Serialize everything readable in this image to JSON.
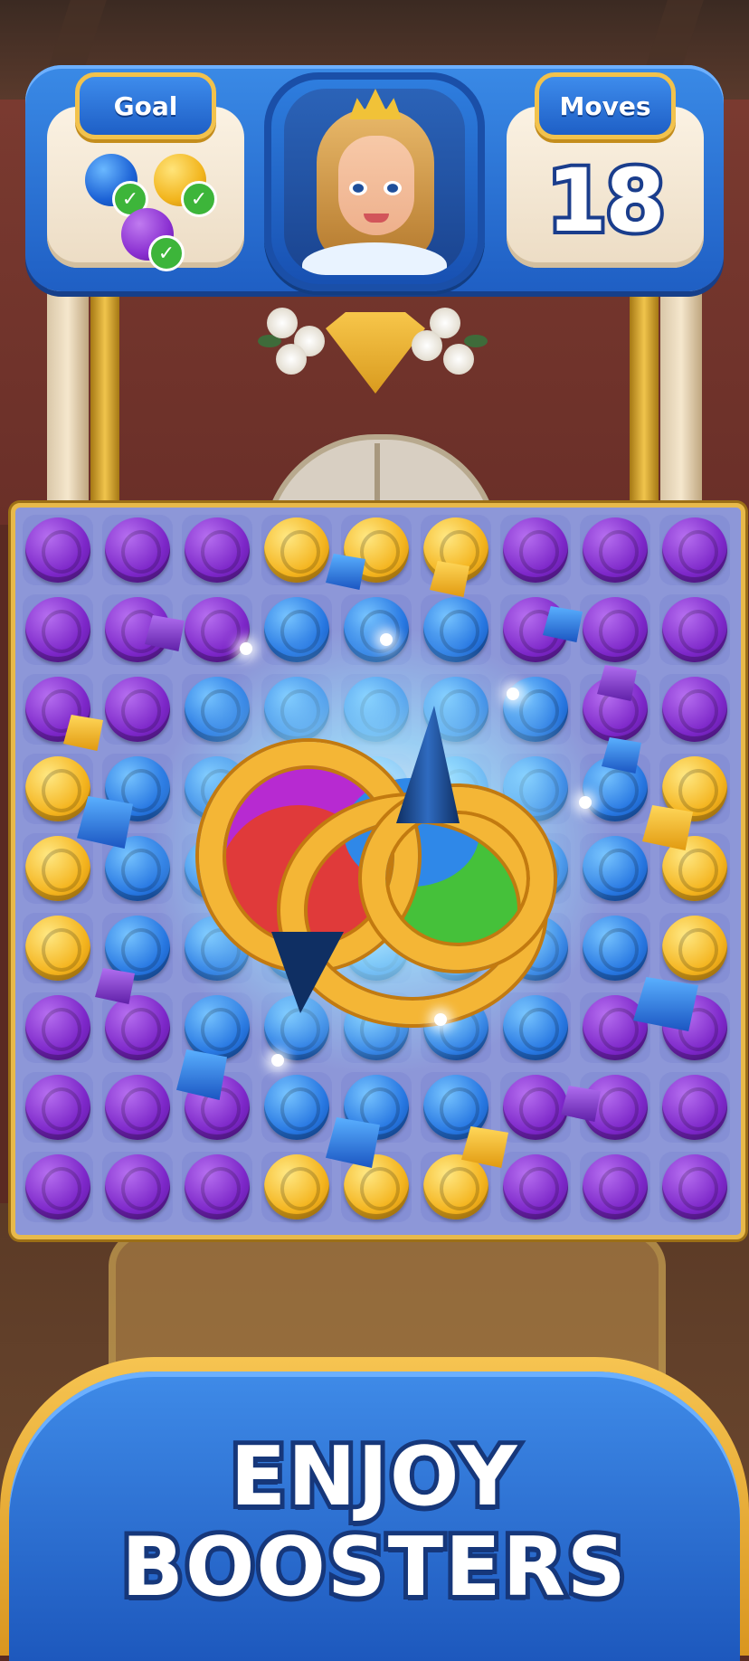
{
  "hud": {
    "goal_label": "Goal",
    "moves_label": "Moves",
    "moves_value": "18",
    "goals": [
      {
        "gem": "blue",
        "icon": "water-drop-icon",
        "completed": true
      },
      {
        "gem": "gold",
        "icon": "crown-icon",
        "completed": true
      },
      {
        "gem": "purple",
        "icon": "shield-icon",
        "completed": true
      }
    ],
    "check_glyph": "✓"
  },
  "board": {
    "rows": [
      [
        "purple",
        "purple",
        "purple",
        "gold",
        "gold",
        "gold",
        "purple",
        "purple",
        "purple"
      ],
      [
        "purple",
        "purple",
        "purple",
        "blue",
        "blue",
        "blue",
        "purple",
        "purple",
        "purple"
      ],
      [
        "purple",
        "purple",
        "blue",
        "blue",
        "blue",
        "blue",
        "blue",
        "purple",
        "purple"
      ],
      [
        "gold",
        "blue",
        "blue",
        "blue",
        "blue",
        "blue",
        "blue",
        "blue",
        "gold"
      ],
      [
        "gold",
        "blue",
        "blue",
        "blue",
        "blue",
        "blue",
        "blue",
        "blue",
        "gold"
      ],
      [
        "gold",
        "blue",
        "blue",
        "blue",
        "blue",
        "blue",
        "blue",
        "blue",
        "gold"
      ],
      [
        "purple",
        "purple",
        "blue",
        "blue",
        "blue",
        "blue",
        "blue",
        "purple",
        "purple"
      ],
      [
        "purple",
        "purple",
        "purple",
        "blue",
        "blue",
        "blue",
        "purple",
        "purple",
        "purple"
      ],
      [
        "purple",
        "purple",
        "purple",
        "gold",
        "gold",
        "gold",
        "purple",
        "purple",
        "purple"
      ]
    ],
    "booster": "rainbow-spinning-top-booster"
  },
  "banner": {
    "line1": "ENJOY",
    "line2": "BOOSTERS"
  },
  "colors": {
    "hud_blue": "#2a72d8",
    "gold_trim": "#f2c24c",
    "purple_gem": "#7d27c9",
    "blue_gem": "#2878e2",
    "gold_gem": "#f4b41e"
  }
}
